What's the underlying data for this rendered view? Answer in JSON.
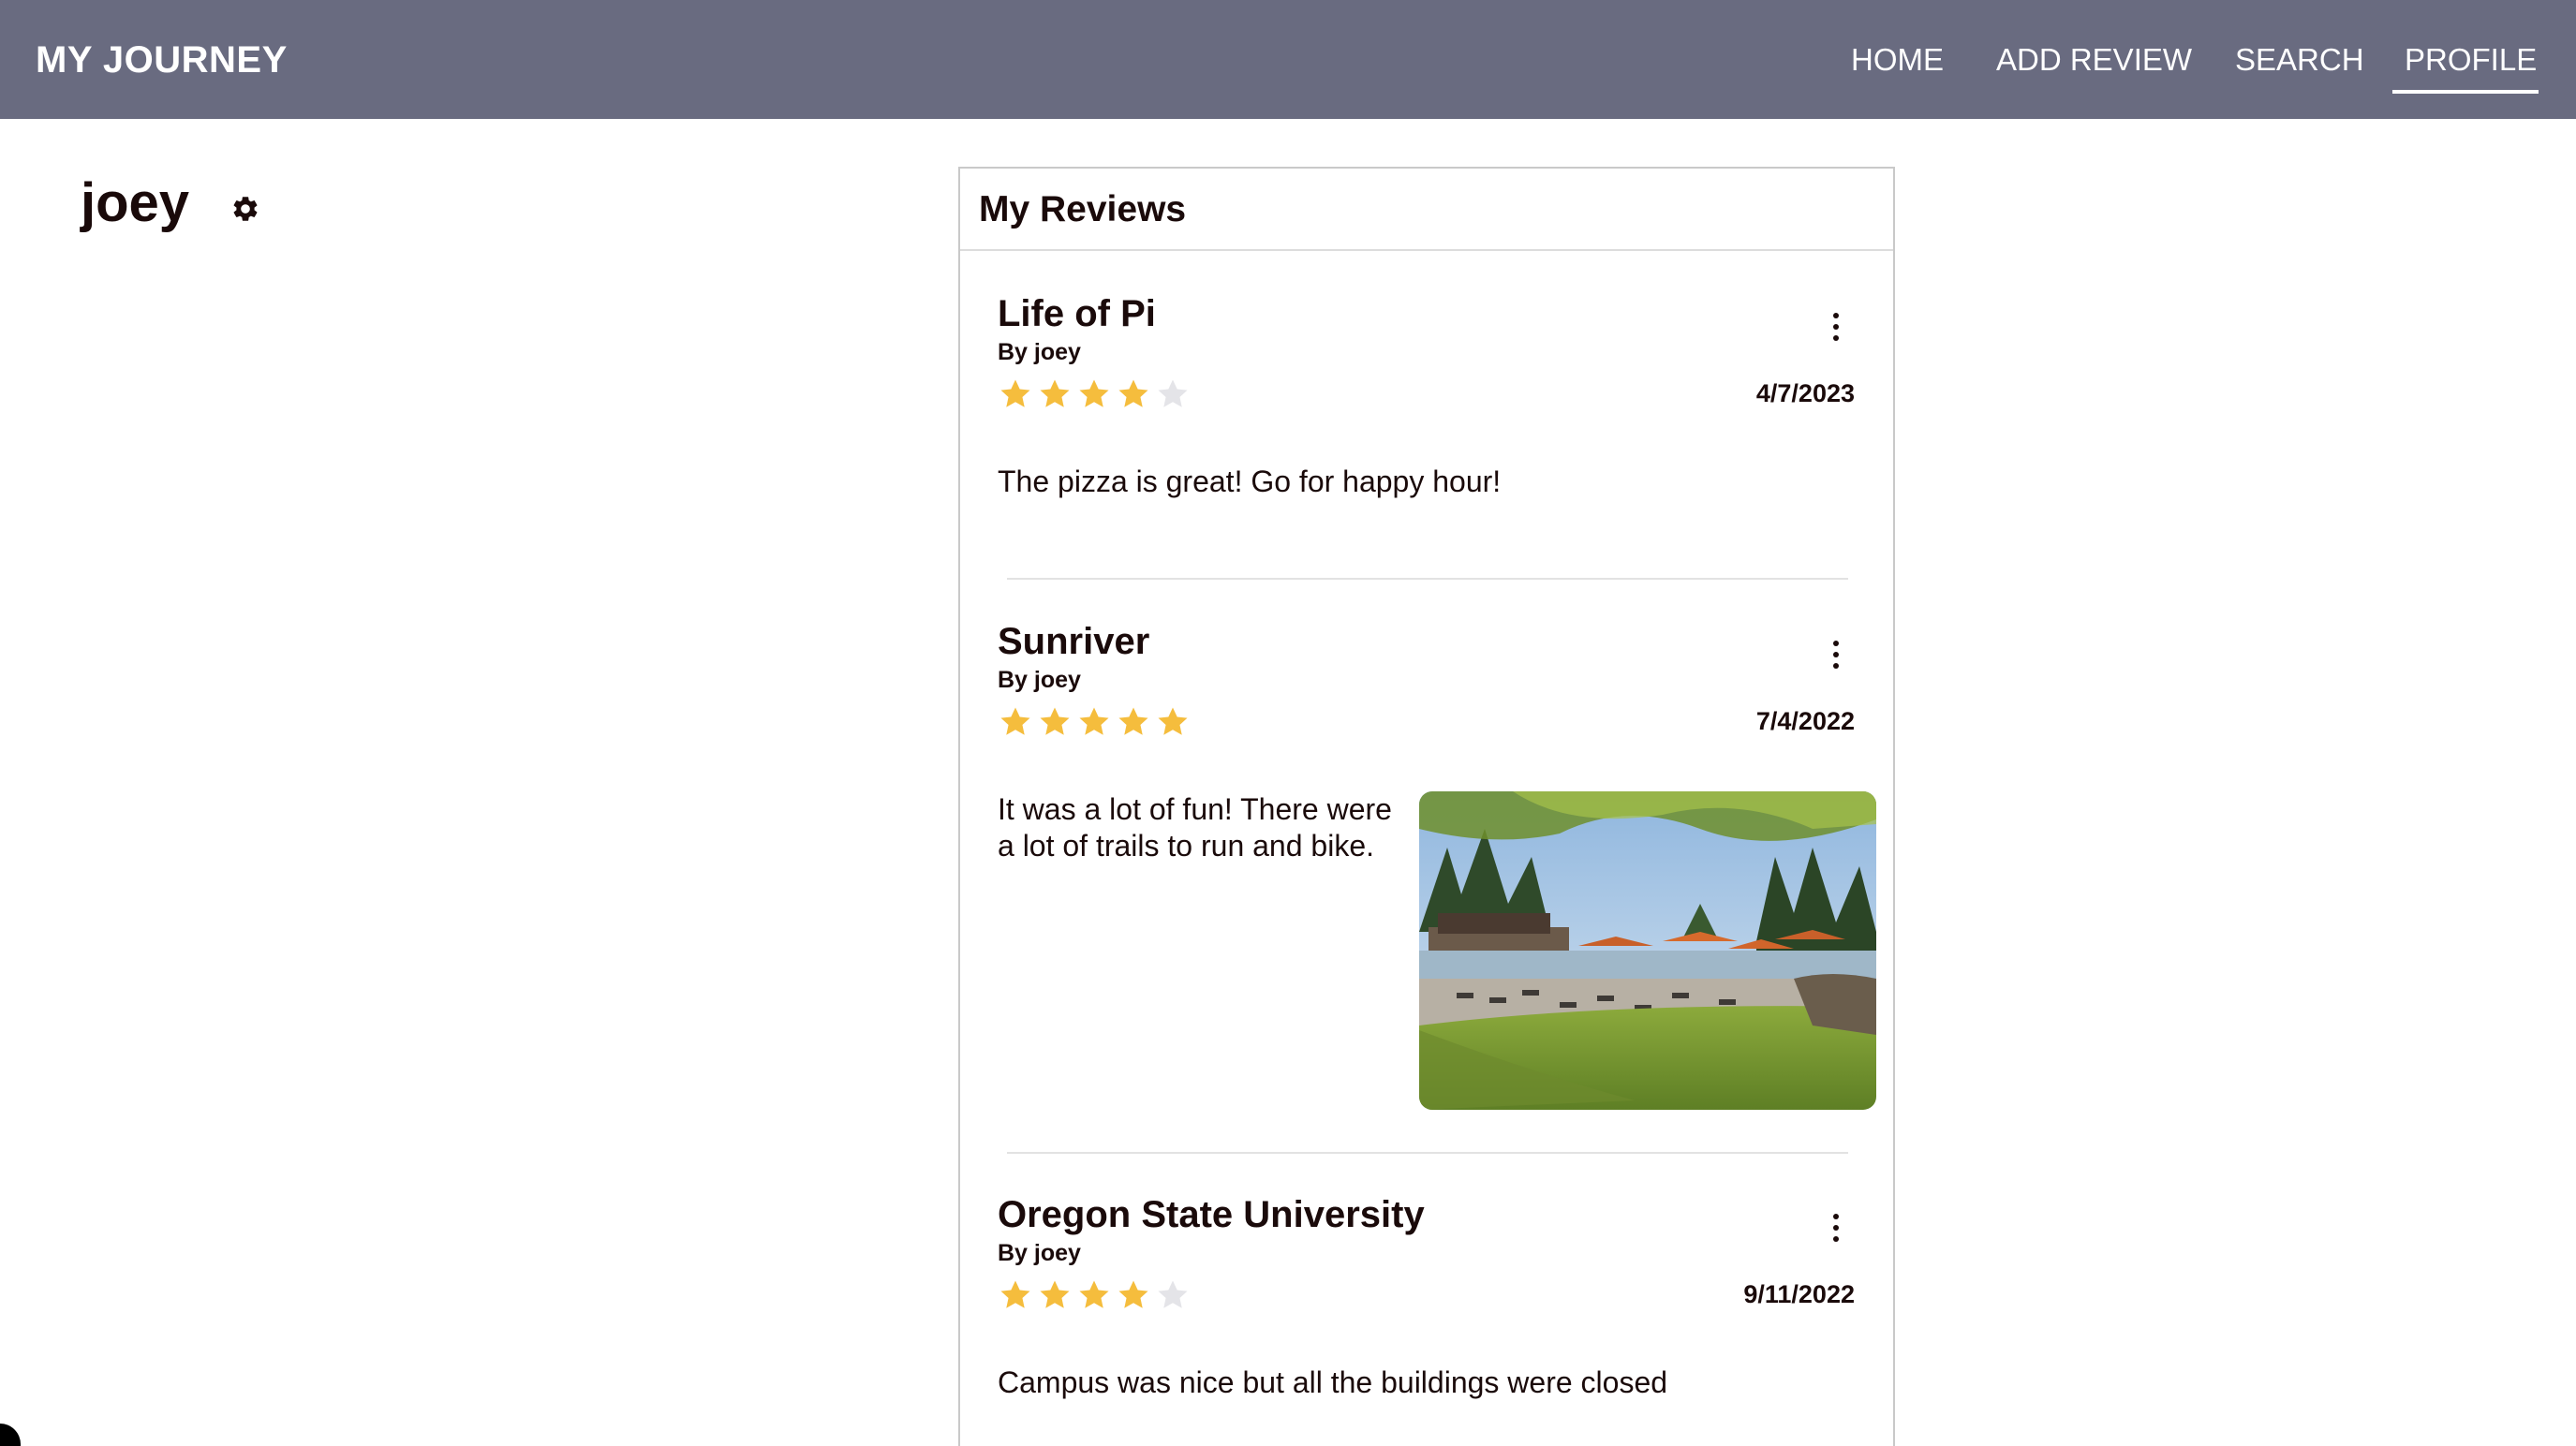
{
  "app": {
    "brand": "MY JOURNEY"
  },
  "nav": {
    "items": [
      {
        "label": "HOME",
        "active": false
      },
      {
        "label": "ADD REVIEW",
        "active": false
      },
      {
        "label": "SEARCH",
        "active": false
      },
      {
        "label": "PROFILE",
        "active": true
      }
    ]
  },
  "profile": {
    "username": "joey",
    "settings_icon": "gear-icon"
  },
  "reviews_panel": {
    "title": "My Reviews",
    "reviews": [
      {
        "title": "Life of Pi",
        "author": "By joey",
        "rating": 4,
        "max_rating": 5,
        "date": "4/7/2023",
        "text": "The pizza is great! Go for happy hour!",
        "has_photo": false
      },
      {
        "title": "Sunriver",
        "author": "By joey",
        "rating": 5,
        "max_rating": 5,
        "date": "7/4/2022",
        "text": "It was a lot of fun! There were a lot of trails to run and bike.",
        "has_photo": true
      },
      {
        "title": "Oregon State University",
        "author": "By joey",
        "rating": 4,
        "max_rating": 5,
        "date": "9/11/2022",
        "text": "Campus was nice but all the buildings were closed",
        "has_photo": false
      }
    ]
  },
  "colors": {
    "navbar": "#696b80",
    "star_filled": "#f5bd3d",
    "star_empty": "#e4e4e8",
    "text": "#1a0a0a"
  }
}
